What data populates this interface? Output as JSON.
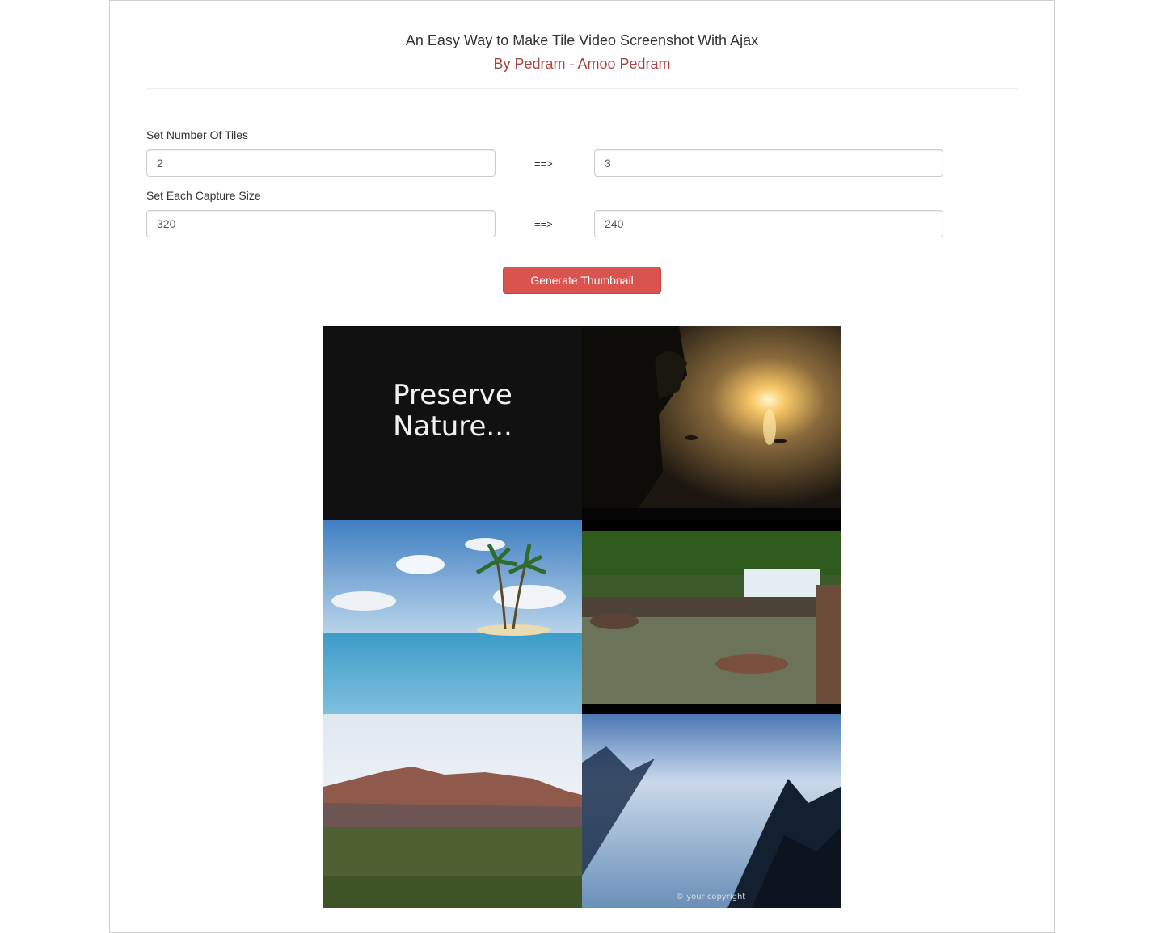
{
  "header": {
    "title": "An Easy Way to Make Tile Video Screenshot With Ajax",
    "subtitle": "By Pedram - Amoo Pedram"
  },
  "form": {
    "tiles_label": "Set Number Of Tiles",
    "tiles_columns_value": "2",
    "tiles_rows_value": "3",
    "size_label": "Set Each Capture Size",
    "size_width_value": "320",
    "size_height_value": "240",
    "arrow": "==>",
    "generate_label": "Generate Thumbnail"
  },
  "thumbnail": {
    "tile1_text_line1": "Preserve",
    "tile1_text_line2": "Nature...",
    "tile6_copyright": "© your copyright"
  },
  "colors": {
    "accent": "#d9534f",
    "subtitle": "#a94442"
  }
}
